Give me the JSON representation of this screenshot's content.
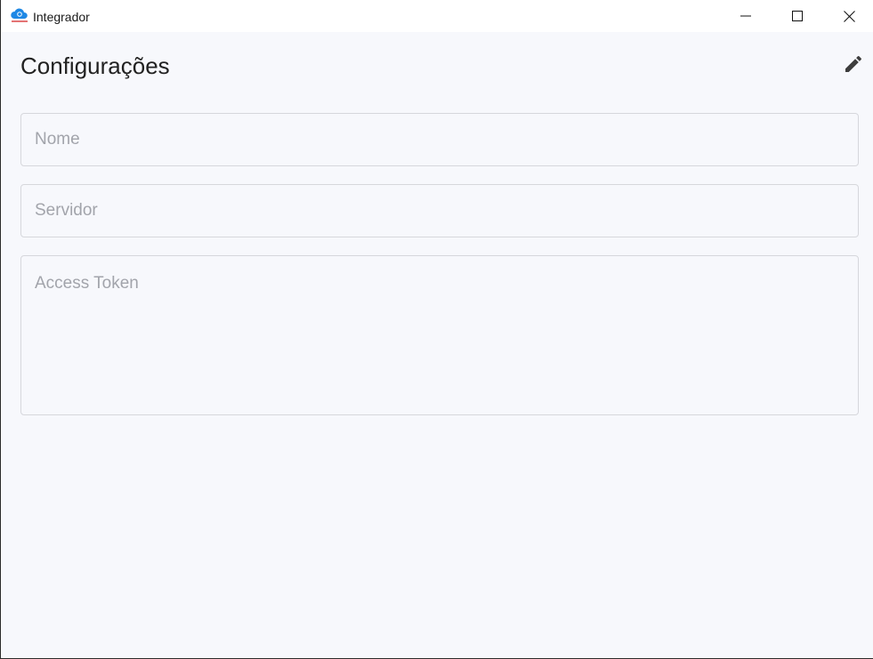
{
  "window": {
    "title": "Integrador",
    "icon": "cloud-logo-icon",
    "controls": {
      "minimize_icon": "minimize-icon",
      "maximize_icon": "maximize-icon",
      "close_icon": "close-icon"
    }
  },
  "page": {
    "title": "Configurações",
    "edit_icon": "pencil-icon"
  },
  "form": {
    "nome": {
      "value": "",
      "placeholder": "Nome"
    },
    "servidor": {
      "value": "",
      "placeholder": "Servidor"
    },
    "access_token": {
      "value": "",
      "placeholder": "Access Token"
    }
  },
  "colors": {
    "background": "#f7f8fc",
    "field_border": "#d6d7dc",
    "placeholder": "#a2a4ab",
    "logo_blue": "#1e88e5"
  }
}
